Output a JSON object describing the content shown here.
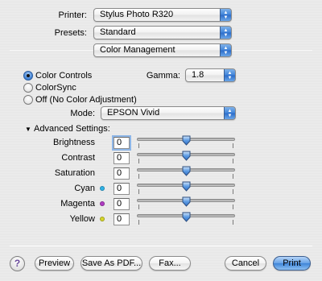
{
  "printer": {
    "label": "Printer:",
    "value": "Stylus Photo R320"
  },
  "presets": {
    "label": "Presets:",
    "value": "Standard"
  },
  "panel": {
    "value": "Color Management"
  },
  "color_options": [
    {
      "label": "Color Controls",
      "selected": true
    },
    {
      "label": "ColorSync",
      "selected": false
    },
    {
      "label": "Off (No Color Adjustment)",
      "selected": false
    }
  ],
  "gamma": {
    "label": "Gamma:",
    "value": "1.8"
  },
  "mode": {
    "label": "Mode:",
    "value": "EPSON Vivid"
  },
  "advanced": {
    "label": "Advanced Settings:",
    "disclosure": "▼"
  },
  "adjustments": [
    {
      "label": "Brightness",
      "value": "0",
      "level": 0.5
    },
    {
      "label": "Contrast",
      "value": "0",
      "level": 0.5
    },
    {
      "label": "Saturation",
      "value": "0",
      "level": 0.5
    },
    {
      "label": "Cyan",
      "value": "0",
      "level": 0.5,
      "dot_color": "#2fb3e8"
    },
    {
      "label": "Magenta",
      "value": "0",
      "level": 0.5,
      "dot_color": "#b13bc4"
    },
    {
      "label": "Yellow",
      "value": "0",
      "level": 0.5,
      "dot_color": "#d6d62a"
    }
  ],
  "buttons": {
    "help": "?",
    "preview": "Preview",
    "save_as_pdf": "Save As PDF...",
    "fax": "Fax...",
    "cancel": "Cancel",
    "print": "Print"
  },
  "icons": {
    "popup_arrows": "up-down-arrows-icon",
    "help": "question-mark-icon"
  },
  "colors": {
    "accent": "#3f83d9",
    "background": "#ececec"
  }
}
